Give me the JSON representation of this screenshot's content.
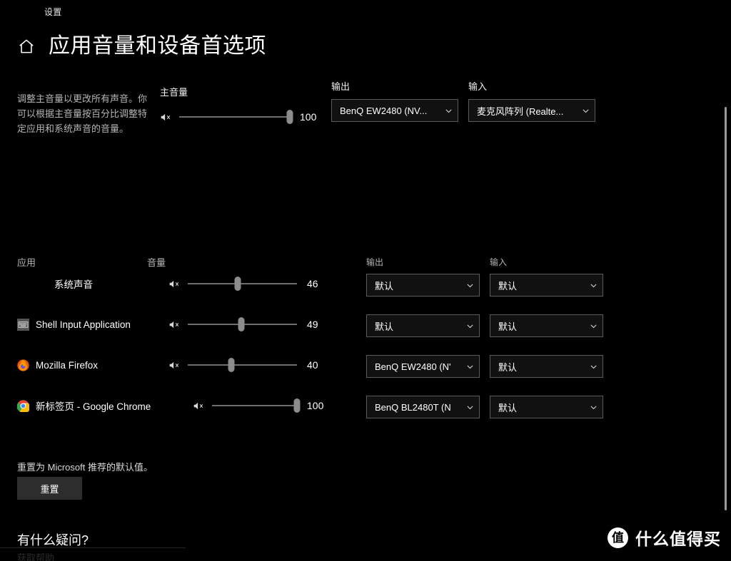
{
  "window": {
    "titlebar_label": "设置"
  },
  "header": {
    "home_icon": "home-icon",
    "page_title": "应用音量和设备首选项"
  },
  "master": {
    "description": "调整主音量以更改所有声音。你可以根据主音量按百分比调整特定应用和系统声音的音量。",
    "volume_label": "主音量",
    "mute_icon": "speaker-mute-icon",
    "volume_value": "100",
    "volume_percent": 100,
    "output_label": "输出",
    "output_device": "BenQ EW2480 (NV...",
    "input_label": "输入",
    "input_device": "麦克风阵列 (Realte..."
  },
  "app_list": {
    "col_app": "应用",
    "col_volume": "音量",
    "col_output": "输出",
    "col_input": "输入",
    "rows": [
      {
        "icon": "none",
        "name": "系统声音",
        "mute_icon": "speaker-mute-icon",
        "volume_value": "46",
        "volume_percent": 46,
        "output": "默认",
        "input": "默认"
      },
      {
        "icon": "keyboard-icon",
        "name": "Shell Input Application",
        "mute_icon": "speaker-mute-icon",
        "volume_value": "49",
        "volume_percent": 49,
        "output": "默认",
        "input": "默认"
      },
      {
        "icon": "firefox-icon",
        "name": "Mozilla Firefox",
        "mute_icon": "speaker-mute-icon",
        "volume_value": "40",
        "volume_percent": 40,
        "output": "BenQ EW2480 (N'",
        "input": "默认"
      },
      {
        "icon": "chrome-icon",
        "name": "新标签页 - Google Chrome",
        "mute_icon": "speaker-mute-icon",
        "volume_value": "100",
        "volume_percent": 100,
        "output": "BenQ BL2480T (N",
        "input": "默认"
      }
    ]
  },
  "reset": {
    "description": "重置为 Microsoft 推荐的默认值。",
    "button_label": "重置"
  },
  "faq": {
    "title": "有什么疑问?",
    "link_label": "获取帮助"
  },
  "watermark": {
    "badge": "值",
    "text": "什么值得买"
  }
}
